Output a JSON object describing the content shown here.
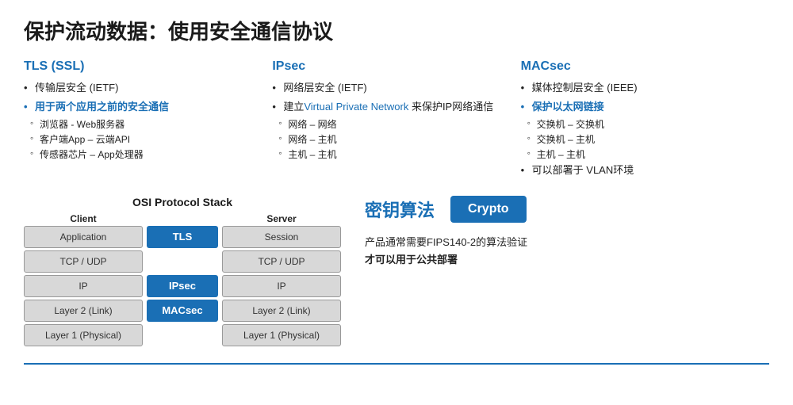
{
  "page": {
    "title": "保护流动数据：使用安全通信协议"
  },
  "tls": {
    "heading": "TLS (SSL)",
    "bullets": [
      {
        "text": "传输层安全 (IETF)",
        "blue": false
      },
      {
        "text": "用于两个应用之前的安全通信",
        "blue": true
      },
      {
        "text": "浏览器 - Web服务器",
        "sub": true
      },
      {
        "text": "客户端App – 云端API",
        "sub": true
      },
      {
        "text": "传感器芯片 – App处理器",
        "sub": true
      }
    ]
  },
  "ipsec": {
    "heading": "IPsec",
    "bullets": [
      {
        "text": "网络层安全 (IETF)",
        "blue": false
      },
      {
        "text": "建立",
        "link": "Virtual Private Network",
        "suffix": " 来保护IP网络通信",
        "blue": false,
        "multipart": true
      },
      {
        "text": "网络 – 网络",
        "sub": true
      },
      {
        "text": "网络 – 主机",
        "sub": true
      },
      {
        "text": "主机 – 主机",
        "sub": true
      }
    ]
  },
  "macsec": {
    "heading": "MACsec",
    "bullets": [
      {
        "text": "媒体控制层安全 (IEEE)",
        "blue": false
      },
      {
        "text": "保护以太网链接",
        "blue": true
      },
      {
        "text": "交换机 – 交换机",
        "sub": true
      },
      {
        "text": "交换机 – 主机",
        "sub": true
      },
      {
        "text": "主机 – 主机",
        "sub": true
      },
      {
        "text": "可以部署于 VLAN环境",
        "blue": false
      }
    ]
  },
  "osi": {
    "title": "OSI  Protocol Stack",
    "client_header": "Client",
    "server_header": "Server",
    "rows": [
      {
        "client": "Application",
        "protocol": "TLS",
        "server": "Session",
        "has_protocol": true,
        "protocol_color": "blue"
      },
      {
        "client": "TCP / UDP",
        "protocol": "",
        "server": "TCP / UDP",
        "has_protocol": false
      },
      {
        "client": "IP",
        "protocol": "IPsec",
        "server": "IP",
        "has_protocol": true,
        "protocol_color": "blue"
      },
      {
        "client": "Layer 2 (Link)",
        "protocol": "MACsec",
        "server": "Layer 2 (Link)",
        "has_protocol": true,
        "protocol_color": "blue"
      },
      {
        "client": "Layer 1 (Physical)",
        "protocol": "",
        "server": "Layer 1 (Physical)",
        "has_protocol": false
      }
    ]
  },
  "crypto": {
    "heading": "密钥算法",
    "button_label": "Crypto",
    "description_line1": "产品通常需要FIPS140-2的算法验证",
    "description_line2": "才可以用于公共部署"
  }
}
